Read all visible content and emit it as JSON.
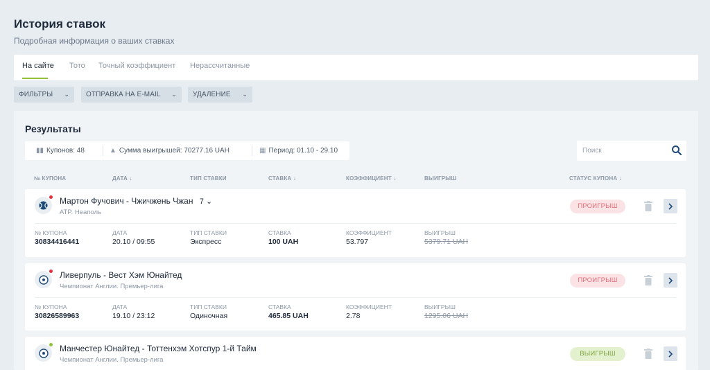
{
  "header": {
    "title": "История ставок",
    "subtitle": "Подробная информация о ваших ставках"
  },
  "tabs": [
    {
      "label": "На сайте",
      "active": true
    },
    {
      "label": "Тото",
      "active": false
    },
    {
      "label": "Точный коэффициент",
      "active": false
    },
    {
      "label": "Нерассчитанные",
      "active": false
    }
  ],
  "filters": [
    {
      "label": "ФИЛЬТРЫ"
    },
    {
      "label": "ОТПРАВКА НА E-MAIL"
    },
    {
      "label": "УДАЛЕНИЕ"
    }
  ],
  "results": {
    "title": "Результаты",
    "summary": {
      "coupons": "Купонов: 48",
      "winnings": "Сумма выигрышей: 70277.16 UAH",
      "period": "Период: 01.10 - 29.10"
    },
    "search": {
      "placeholder": "Поиск"
    },
    "columns": {
      "coupon": "№ КУПОНА",
      "date": "ДАТА",
      "type": "ТИП СТАВКИ",
      "stake": "СТАВКА",
      "coef": "КОЭФФИЦИЕНТ",
      "win": "ВЫИГРЫШ",
      "status": "СТАТУС КУПОНА"
    }
  },
  "labels": {
    "coupon": "№ КУПОНА",
    "date": "ДАТА",
    "type": "ТИП СТАВКИ",
    "stake": "СТАВКА",
    "coef": "КОЭФФИЦИЕНТ",
    "win": "ВЫИГРЫШ"
  },
  "coupons": [
    {
      "event": "Мартон Фучович - Чжичжень Чжан",
      "count": "7",
      "league": "ATP. Неаполь",
      "sport_icon": "tennis-ball-icon",
      "coupon_no": "30834416441",
      "date": "20.10 / 09:55",
      "type": "Экспресс",
      "stake": "100 UAH",
      "coef": "53.797",
      "win": "5379.71 UAH",
      "status": "ПРОИГРЫШ",
      "status_kind": "lose"
    },
    {
      "event": "Ливерпуль - Вест Хэм Юнайтед",
      "league": "Чемпионат Англии. Премьер-лига",
      "sport_icon": "soccer-ball-icon",
      "coupon_no": "30826589963",
      "date": "19.10 / 23:12",
      "type": "Одиночная",
      "stake": "465.85 UAH",
      "coef": "2.78",
      "win": "1295.06 UAH",
      "status": "ПРОИГРЫШ",
      "status_kind": "lose"
    },
    {
      "event": "Манчестер Юнайтед - Тоттенхэм Хотспур 1-й Тайм",
      "league": "Чемпионат Англии. Премьер-лига",
      "sport_icon": "soccer-ball-icon",
      "status": "ВЫИГРЫШ",
      "status_kind": "win"
    }
  ],
  "colors": {
    "accent_green": "#8fc13a",
    "lose_red": "#e36f79",
    "win_green": "#7ea23f",
    "background": "#e8edf2"
  }
}
